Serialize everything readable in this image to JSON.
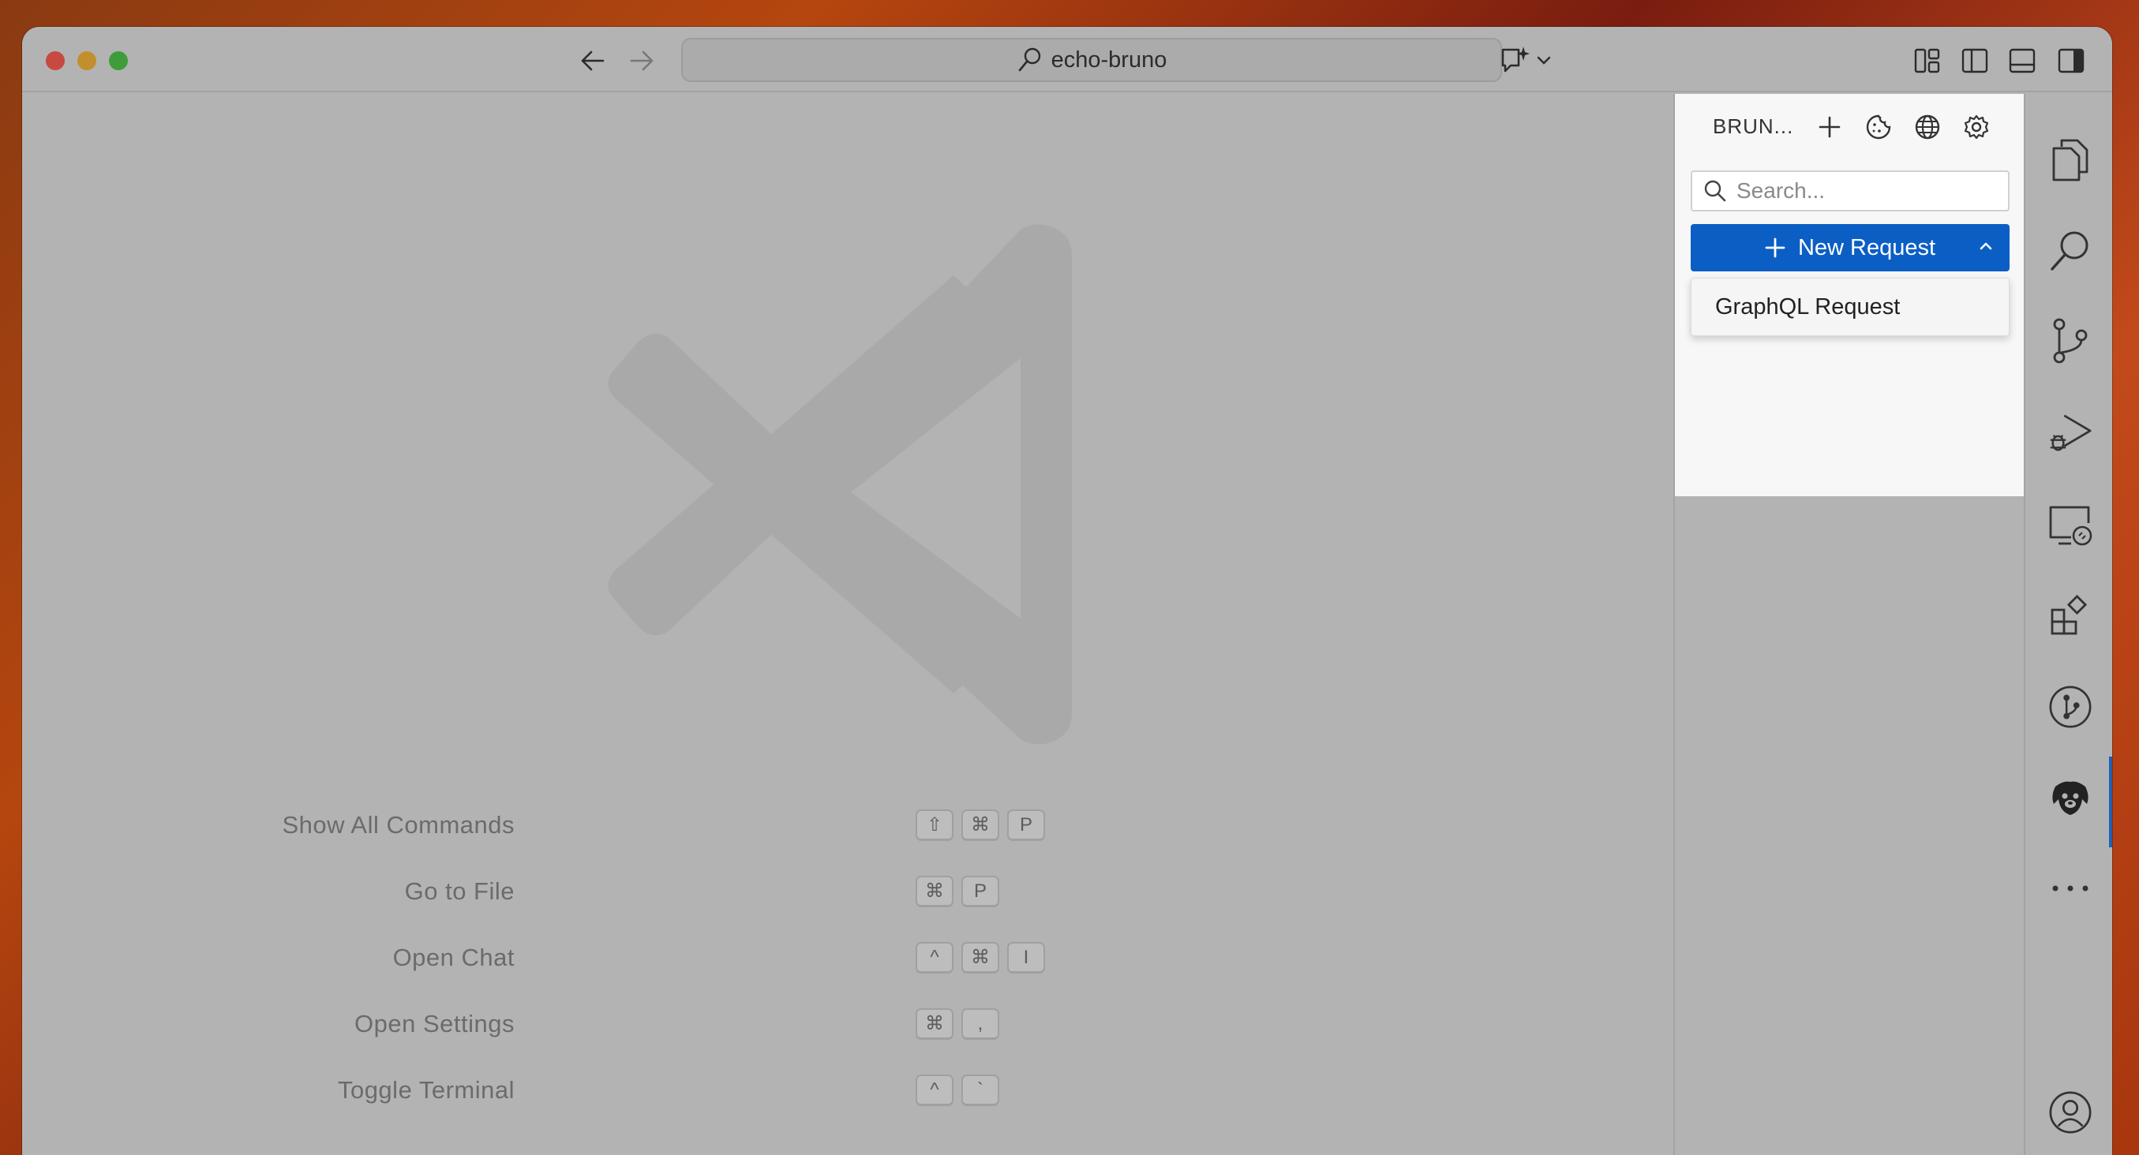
{
  "titlebar": {
    "search_text": "echo-bruno"
  },
  "editor": {
    "shortcuts": [
      {
        "label": "Show All Commands",
        "keys": [
          "⇧",
          "⌘",
          "P"
        ]
      },
      {
        "label": "Go to File",
        "keys": [
          "⌘",
          "P"
        ]
      },
      {
        "label": "Open Chat",
        "keys": [
          "^",
          "⌘",
          "I"
        ]
      },
      {
        "label": "Open Settings",
        "keys": [
          "⌘",
          ","
        ]
      },
      {
        "label": "Toggle Terminal",
        "keys": [
          "^",
          "`"
        ]
      }
    ]
  },
  "panel": {
    "title": "BRUN...",
    "search_placeholder": "Search...",
    "new_request_label": "New Request",
    "dropdown_item": "GraphQL Request"
  },
  "colors": {
    "accent": "#0b5fc4",
    "window_bg": "#b3b3b3",
    "panel_bg": "#f7f7f7"
  }
}
